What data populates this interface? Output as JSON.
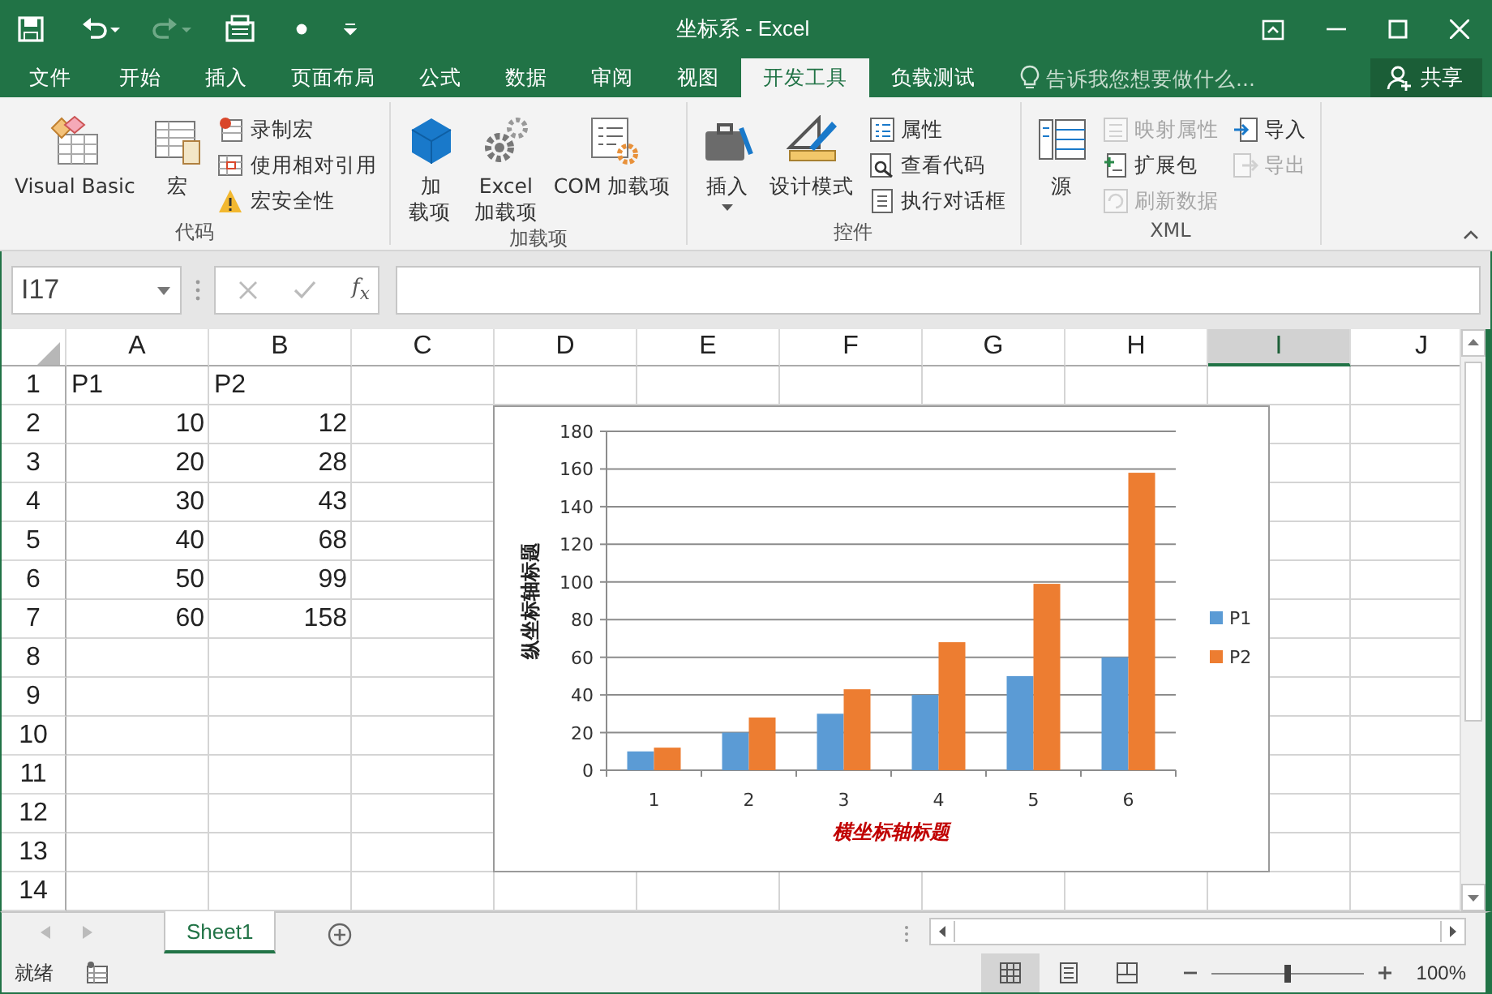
{
  "window": {
    "title": "坐标系 - Excel"
  },
  "tabs": [
    {
      "label": "文件",
      "selected": false
    },
    {
      "label": "开始",
      "selected": false
    },
    {
      "label": "插入",
      "selected": false
    },
    {
      "label": "页面布局",
      "selected": false
    },
    {
      "label": "公式",
      "selected": false
    },
    {
      "label": "数据",
      "selected": false
    },
    {
      "label": "审阅",
      "selected": false
    },
    {
      "label": "视图",
      "selected": false
    },
    {
      "label": "开发工具",
      "selected": true
    },
    {
      "label": "负载测试",
      "selected": false
    }
  ],
  "tell_me": {
    "placeholder": "告诉我您想要做什么..."
  },
  "share_button": "共享",
  "ribbon_groups": [
    {
      "label": "代码",
      "items": [
        {
          "label": "Visual Basic",
          "kind": "large",
          "disabled": false
        },
        {
          "label": "宏",
          "kind": "large",
          "disabled": false
        },
        {
          "label": "录制宏",
          "kind": "small",
          "disabled": false
        },
        {
          "label": "使用相对引用",
          "kind": "small",
          "disabled": false
        },
        {
          "label": "宏安全性",
          "kind": "small",
          "disabled": false
        }
      ]
    },
    {
      "label": "加载项",
      "items": [
        {
          "label": "加载项",
          "kind": "narrow",
          "disabled": false
        },
        {
          "label": "Excel\n加载项",
          "kind": "large",
          "disabled": false
        },
        {
          "label": "COM 加载项",
          "kind": "large",
          "disabled": false
        }
      ]
    },
    {
      "label": "控件",
      "items": [
        {
          "label": "插入",
          "kind": "dropdown",
          "disabled": false
        },
        {
          "label": "设计模式",
          "kind": "large",
          "disabled": false
        },
        {
          "label": "属性",
          "kind": "small",
          "disabled": false
        },
        {
          "label": "查看代码",
          "kind": "small",
          "disabled": false
        },
        {
          "label": "执行对话框",
          "kind": "small",
          "disabled": false
        }
      ]
    },
    {
      "label": "XML",
      "items": [
        {
          "label": "源",
          "kind": "large",
          "disabled": false
        },
        {
          "label": "映射属性",
          "kind": "small",
          "disabled": true
        },
        {
          "label": "扩展包",
          "kind": "small",
          "disabled": false
        },
        {
          "label": "刷新数据",
          "kind": "small",
          "disabled": true
        },
        {
          "label": "导入",
          "kind": "small",
          "disabled": false
        },
        {
          "label": "导出",
          "kind": "small",
          "disabled": true
        }
      ]
    }
  ],
  "name_box": {
    "value": "I17"
  },
  "function_button": "f$_{x}$",
  "columns": [
    {
      "label": "A",
      "selected": false
    },
    {
      "label": "B",
      "selected": false
    },
    {
      "label": "C",
      "selected": false
    },
    {
      "label": "D",
      "selected": false
    },
    {
      "label": "E",
      "selected": false
    },
    {
      "label": "F",
      "selected": false
    },
    {
      "label": "G",
      "selected": false
    },
    {
      "label": "H",
      "selected": false
    },
    {
      "label": "I",
      "selected": true
    },
    {
      "label": "J",
      "selected": false
    }
  ],
  "rows": [
    {
      "header": "1",
      "cells": [
        {
          "value": "P1",
          "kind": "text"
        },
        {
          "value": "P2",
          "kind": "text"
        }
      ]
    },
    {
      "header": "2",
      "cells": [
        {
          "value": "10",
          "kind": "number"
        },
        {
          "value": "12",
          "kind": "number"
        }
      ]
    },
    {
      "header": "3",
      "cells": [
        {
          "value": "20",
          "kind": "number"
        },
        {
          "value": "28",
          "kind": "number"
        }
      ]
    },
    {
      "header": "4",
      "cells": [
        {
          "value": "30",
          "kind": "number"
        },
        {
          "value": "43",
          "kind": "number"
        }
      ]
    },
    {
      "header": "5",
      "cells": [
        {
          "value": "40",
          "kind": "number"
        },
        {
          "value": "68",
          "kind": "number"
        }
      ]
    },
    {
      "header": "6",
      "cells": [
        {
          "value": "50",
          "kind": "number"
        },
        {
          "value": "99",
          "kind": "number"
        }
      ]
    },
    {
      "header": "7",
      "cells": [
        {
          "value": "60",
          "kind": "number"
        },
        {
          "value": "158",
          "kind": "number"
        }
      ]
    },
    {
      "header": "8"
    },
    {
      "header": "9"
    },
    {
      "header": "10"
    },
    {
      "header": "11"
    },
    {
      "header": "12"
    },
    {
      "header": "13"
    },
    {
      "header": "14"
    }
  ],
  "chart": {
    "chart_data": {
      "type": "bar",
      "xlabel": "横坐标轴标题",
      "ylabel": "纵坐标轴标题",
      "categories": [
        "1",
        "2",
        "3",
        "4",
        "5",
        "6"
      ],
      "series": [
        {
          "name": "P1",
          "color": "#5b9bd5",
          "values": [
            10,
            20,
            30,
            40,
            50,
            60
          ]
        },
        {
          "name": "P2",
          "color": "#ed7d31",
          "values": [
            12,
            28,
            43,
            68,
            99,
            158
          ]
        }
      ],
      "grid": true,
      "legend": true,
      "ylim": [
        0,
        180
      ],
      "yticks": [
        0,
        20,
        40,
        60,
        80,
        100,
        120,
        140,
        160,
        180
      ]
    }
  },
  "sheet_tabs": [
    {
      "label": "Sheet1",
      "selected": true
    }
  ],
  "status_bar": {
    "text": "就绪",
    "views": [
      {
        "kind": "normal",
        "selected": true
      },
      {
        "kind": "page-layout",
        "selected": false
      },
      {
        "kind": "page-break",
        "selected": false
      }
    ],
    "zoom": {
      "level": 0.5
    },
    "zoom_text": "100%"
  }
}
